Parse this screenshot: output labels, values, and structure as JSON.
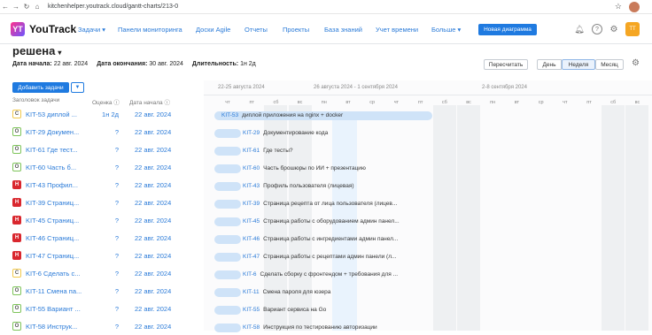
{
  "browser": {
    "url": "kitchenhelper.youtrack.cloud/gantt-charts/213-0"
  },
  "app": {
    "name": "YouTrack"
  },
  "nav": {
    "items": [
      "Задачи",
      "Панели мониторинга",
      "Доски Agile",
      "Отчеты",
      "Проекты",
      "База знаний",
      "Учет времени",
      "Больше"
    ],
    "new_chart": "Новая диаграмма"
  },
  "user": {
    "initials": "ТТ"
  },
  "page": {
    "title": "решена",
    "start_label": "Дата начала:",
    "start_value": "22 авг. 2024",
    "end_label": "Дата окончания:",
    "end_value": "30 авг. 2024",
    "dur_label": "Длительность:",
    "dur_value": "1н 2д"
  },
  "toolbar": {
    "recalc": "Пересчитать",
    "day": "День",
    "week": "Неделя",
    "month": "Месяц",
    "add_task": "Добавить задачи"
  },
  "columns": {
    "summary": "Заголовок задачи",
    "estimate": "Оценка",
    "start": "Дата начала"
  },
  "weeks": [
    "22-25 августа 2024",
    "26 августа 2024 - 1 сентября 2024",
    "2-8 сентября 2024"
  ],
  "days": [
    "чт",
    "пт",
    "сб",
    "вс",
    "пн",
    "вт",
    "ср",
    "чт",
    "пт",
    "сб",
    "вс",
    "пн",
    "вт",
    "ср",
    "чт",
    "пт",
    "сб",
    "вс"
  ],
  "tasks": [
    {
      "badge": "С",
      "color": "#f2c94c",
      "key": "KIT-53",
      "short": "диплой ...",
      "est": "1н 2д",
      "start": "22 авг. 2024",
      "full": "диплой приложения на nginx + docker"
    },
    {
      "badge": "О",
      "color": "#7ec45a",
      "key": "KIT-29",
      "short": "Докумен...",
      "est": "?",
      "start": "22 авг. 2024",
      "full": "Документирование кода"
    },
    {
      "badge": "О",
      "color": "#7ec45a",
      "key": "KIT-61",
      "short": "Где тест...",
      "est": "?",
      "start": "22 авг. 2024",
      "full": "Где тесты?"
    },
    {
      "badge": "О",
      "color": "#7ec45a",
      "key": "KIT-60",
      "short": "Часть б...",
      "est": "?",
      "start": "22 авг. 2024",
      "full": "Часть брошюры по ИИ + презентацию"
    },
    {
      "badge": "Н",
      "color": "#d9272e",
      "key": "KIT-43",
      "short": "Профил...",
      "est": "?",
      "start": "22 авг. 2024",
      "full": "Профиль пользователя (лицевая)"
    },
    {
      "badge": "Н",
      "color": "#d9272e",
      "key": "KIT-39",
      "short": "Страниц...",
      "est": "?",
      "start": "22 авг. 2024",
      "full": "Страница рецепта от лица пользователя (лицев..."
    },
    {
      "badge": "Н",
      "color": "#d9272e",
      "key": "KIT-45",
      "short": "Страниц...",
      "est": "?",
      "start": "22 авг. 2024",
      "full": "Страница работы с оборудованием админ панел..."
    },
    {
      "badge": "Н",
      "color": "#d9272e",
      "key": "KIT-46",
      "short": "Страниц...",
      "est": "?",
      "start": "22 авг. 2024",
      "full": "Страница работы с ингредиентами админ панел..."
    },
    {
      "badge": "Н",
      "color": "#d9272e",
      "key": "KIT-47",
      "short": "Страниц...",
      "est": "?",
      "start": "22 авг. 2024",
      "full": "Страница работы с рецептами админ панели (л..."
    },
    {
      "badge": "С",
      "color": "#f2c94c",
      "key": "KIT-6",
      "short": "Сделать с...",
      "est": "?",
      "start": "22 авг. 2024",
      "full": "Сделать сборку с фронтендом + требования для ..."
    },
    {
      "badge": "О",
      "color": "#7ec45a",
      "key": "KIT-11",
      "short": "Смена па...",
      "est": "?",
      "start": "22 авг. 2024",
      "full": "Смена пароля для юзера"
    },
    {
      "badge": "О",
      "color": "#7ec45a",
      "key": "KIT-55",
      "short": "Вариант ...",
      "est": "?",
      "start": "22 авг. 2024",
      "full": "Вариант сервиса на Go"
    },
    {
      "badge": "О",
      "color": "#7ec45a",
      "key": "KIT-58",
      "short": "Инструк...",
      "est": "?",
      "start": "22 авг. 2024",
      "full": "Инструкция по тестированию авторизации"
    }
  ]
}
